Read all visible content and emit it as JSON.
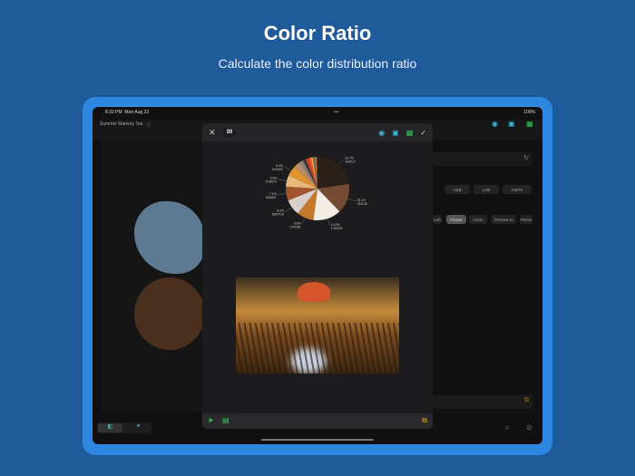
{
  "hero": {
    "title": "Color Ratio",
    "subtitle": "Calculate the color distribution ratio"
  },
  "status": {
    "time": "8:32 PM",
    "date": "Mon Aug 22",
    "battery": "100%"
  },
  "app": {
    "project_name": "Summer Mammy Tea"
  },
  "format_options": [
    "HSB",
    "LAB",
    "CMYK"
  ],
  "style_options": [
    {
      "label": "Left",
      "selected": false
    },
    {
      "label": "Flower",
      "selected": true
    },
    {
      "label": "Circle",
      "selected": false
    },
    {
      "label": "Percent.H",
      "selected": false
    },
    {
      "label": "Perce",
      "selected": false
    }
  ],
  "modal": {
    "count": "30",
    "chart_data": {
      "type": "pie",
      "slices": [
        {
          "pct": 22.7,
          "hex": "2A2017",
          "color": "#2a2017"
        },
        {
          "pct": 15.1,
          "hex": "734C33",
          "color": "#734c33"
        },
        {
          "pct": 14.3,
          "hex": "F4EDE6",
          "color": "#f4ede6"
        },
        {
          "pct": 8.6,
          "hex": "C4792B",
          "color": "#c4792b"
        },
        {
          "pct": 8.2,
          "hex": "D8CFCA",
          "color": "#d8cfca"
        },
        {
          "pct": 7.1,
          "hex": "A0562F",
          "color": "#a0562f"
        },
        {
          "pct": 5.8,
          "hex": "E7B97C",
          "color": "#e7b97c"
        },
        {
          "pct": 5.4,
          "hex": "E0942E",
          "color": "#e0942e"
        },
        {
          "pct": 3.2,
          "color": "#b98d6a"
        },
        {
          "pct": 2.0,
          "color": "#8a8078"
        },
        {
          "pct": 1.5,
          "color": "#3a3532"
        },
        {
          "pct": 1.5,
          "color": "#c8402a"
        },
        {
          "pct": 1.2,
          "color": "#e25a2a"
        },
        {
          "pct": 1.0,
          "color": "#f0a030"
        },
        {
          "pct": 0.9,
          "color": "#6a6f80"
        },
        {
          "pct": 0.8,
          "color": "#d07030"
        },
        {
          "pct": 0.7,
          "color": "#5a4a40"
        }
      ]
    }
  },
  "colors": {
    "accent": "#2d86e0",
    "teal": "#3fb8d8",
    "green": "#34c759",
    "orange": "#f5a623"
  }
}
